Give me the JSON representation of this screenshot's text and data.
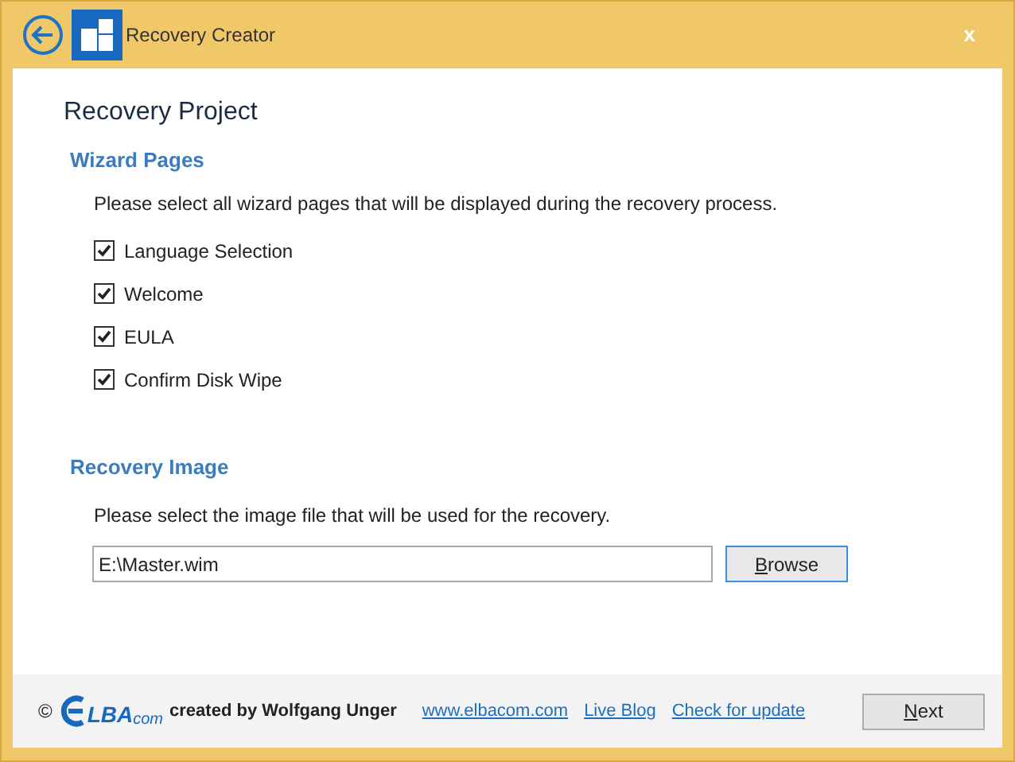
{
  "window": {
    "title": "Recovery Creator",
    "close": "x"
  },
  "heading": "Recovery Project",
  "wizard_pages": {
    "title": "Wizard Pages",
    "description": "Please select all wizard pages that will be displayed during the recovery process.",
    "items": [
      {
        "label": "Language Selection",
        "checked": true
      },
      {
        "label": "Welcome",
        "checked": true
      },
      {
        "label": "EULA",
        "checked": true
      },
      {
        "label": "Confirm Disk Wipe",
        "checked": true
      }
    ]
  },
  "recovery_image": {
    "title": "Recovery Image",
    "description": "Please select the image file that will be used for the recovery.",
    "value": "E:\\Master.wim",
    "browse": {
      "access_key": "B",
      "label_rest": "rowse"
    }
  },
  "footer": {
    "copyright": "©",
    "logo_text": "LBA",
    "logo_suffix": "com",
    "credit": "created by Wolfgang Unger",
    "links": [
      "www.elbacom.com",
      "Live Blog",
      "Check for update"
    ],
    "next": {
      "access_key": "N",
      "label_rest": "ext"
    }
  }
}
